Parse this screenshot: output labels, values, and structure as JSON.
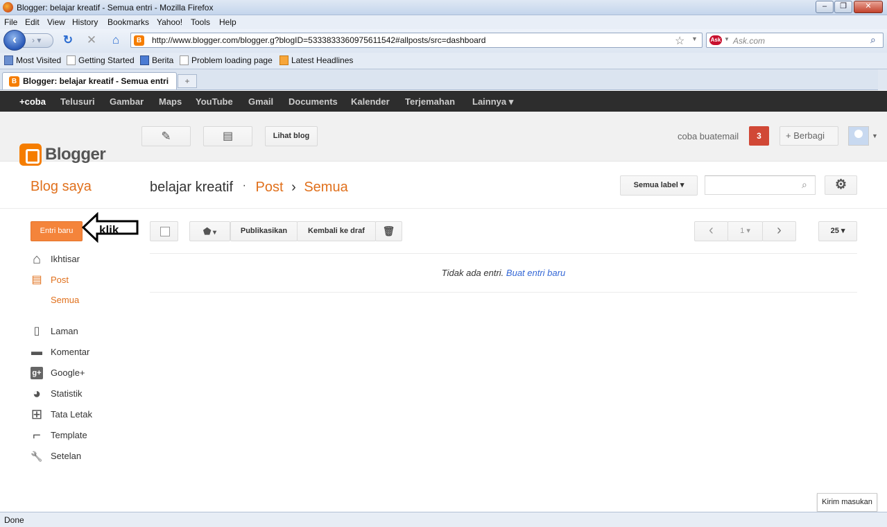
{
  "window": {
    "title": "Blogger: belajar kreatif - Semua entri - Mozilla Firefox",
    "minimize": "–",
    "maximize": "❐",
    "close": "✕"
  },
  "menu": [
    "File",
    "Edit",
    "View",
    "History",
    "Bookmarks",
    "Yahoo!",
    "Tools",
    "Help"
  ],
  "address": {
    "url": "http://www.blogger.com/blogger.g?blogID=5333833360975611542#allposts/src=dashboard"
  },
  "ask": {
    "placeholder": "Ask.com",
    "logo": "Ask"
  },
  "bookmarks": [
    {
      "label": "Most Visited"
    },
    {
      "label": "Getting Started"
    },
    {
      "label": "Berita"
    },
    {
      "label": "Problem loading page"
    },
    {
      "label": "Latest Headlines"
    }
  ],
  "tab": {
    "label": "Blogger: belajar kreatif - Semua entri",
    "new_tab": "+"
  },
  "gbar": [
    "+coba",
    "Telusuri",
    "Gambar",
    "Maps",
    "YouTube",
    "Gmail",
    "Documents",
    "Kalender",
    "Terjemahan",
    "Lainnya ▾"
  ],
  "header": {
    "logo_text": "Blogger",
    "view_blog": "Lihat blog",
    "user": "coba buatemail",
    "notifications": "3",
    "share": "+ Berbagi"
  },
  "page": {
    "blog_saya": "Blog saya",
    "blog_name": "belajar kreatif",
    "sep": "·",
    "post": "Post",
    "chev": "›",
    "semua": "Semua",
    "label_filter": "Semua label ▾"
  },
  "sidebar": {
    "new_post": "Entri baru",
    "klik": "klik",
    "items": [
      {
        "icon": "home-icon",
        "glyph": "⌂",
        "label": "Ikhtisar"
      },
      {
        "icon": "posts-icon",
        "glyph": "▤",
        "label": "Post",
        "active": true
      },
      {
        "label": "Semua",
        "sub": true
      },
      {
        "icon": "pages-icon",
        "glyph": "▯",
        "label": "Laman"
      },
      {
        "icon": "comment-icon",
        "glyph": "▬",
        "label": "Komentar"
      },
      {
        "icon": "google-plus-icon",
        "glyph": "g+",
        "label": "Google+"
      },
      {
        "icon": "stats-icon",
        "glyph": "◕",
        "label": "Statistik"
      },
      {
        "icon": "layout-icon",
        "glyph": "⊞",
        "label": "Tata Letak"
      },
      {
        "icon": "template-icon",
        "glyph": "⌐",
        "label": "Template"
      },
      {
        "icon": "settings-wrench-icon",
        "glyph": "🔧",
        "label": "Setelan"
      }
    ]
  },
  "toolbar": {
    "label_btn": "▾",
    "publish": "Publikasikan",
    "revert": "Kembali ke draf",
    "prev": "‹",
    "page": "1 ▾",
    "next": "›",
    "per_page": "25 ▾"
  },
  "empty": {
    "text": "Tidak ada entri.",
    "link": "Buat entri baru"
  },
  "feedback": "Kirim masukan",
  "status": "Done"
}
